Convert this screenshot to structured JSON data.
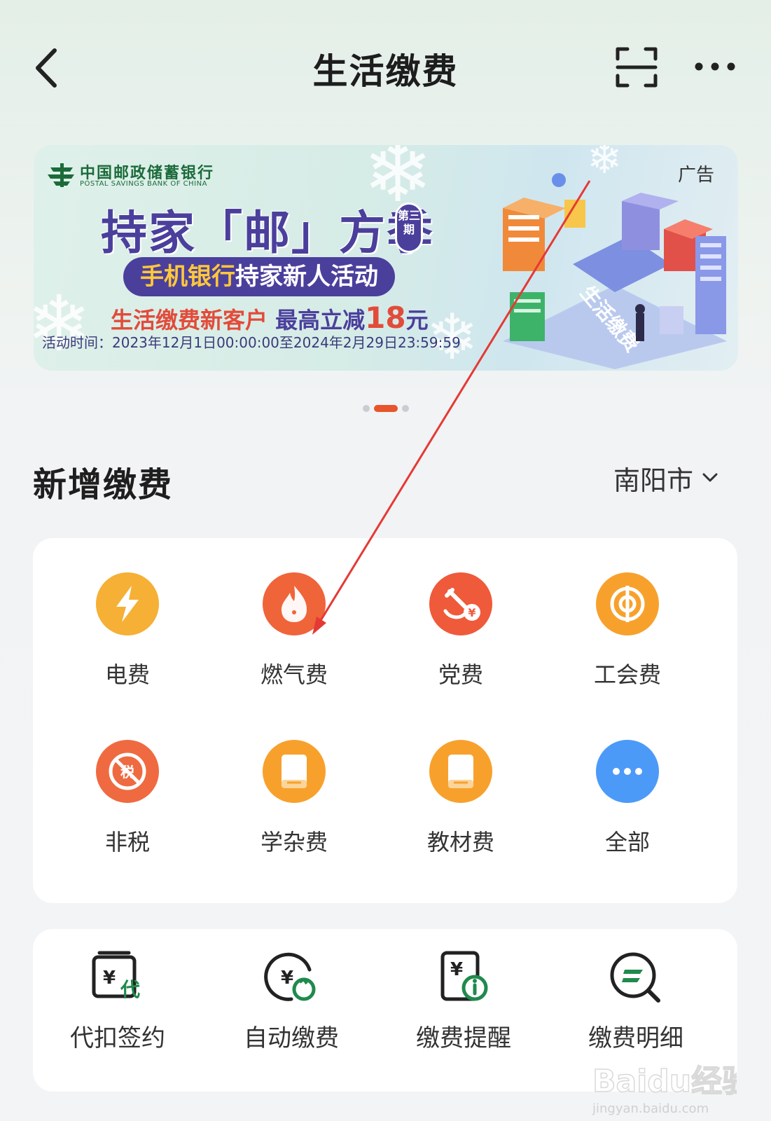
{
  "header": {
    "title": "生活缴费",
    "back_icon": "chevron-left-icon",
    "scan_icon": "scan-icon",
    "more_icon": "more-horizontal-icon"
  },
  "banner": {
    "bank_name": "中国邮政储蓄银行",
    "bank_name_en": "POSTAL SAVINGS BANK OF CHINA",
    "ad_tag": "广告",
    "title": "持家「邮」方季",
    "badge": "第三期",
    "subtitle_highlight": "手机银行",
    "subtitle_rest": "持家新人活动",
    "offer_part1": "生活缴费新客户",
    "offer_part2": "最高立减",
    "offer_amount": "18",
    "offer_unit": "元",
    "time": "活动时间：2023年12月1日00:00:00至2024年2月29日23:59:59",
    "art_street_label": "生活缴费",
    "carousel_total": 3,
    "carousel_active": 2
  },
  "section": {
    "title": "新增缴费",
    "city": "南阳市",
    "city_icon": "chevron-down-icon"
  },
  "payment_types": [
    {
      "label": "电费",
      "icon": "lightning-icon",
      "color": "#f5a623"
    },
    {
      "label": "燃气费",
      "icon": "flame-icon",
      "color": "#f0643a"
    },
    {
      "label": "党费",
      "icon": "party-emblem-icon",
      "color": "#ef5a3a"
    },
    {
      "label": "工会费",
      "icon": "union-emblem-icon",
      "color": "#f7a12c"
    },
    {
      "label": "非税",
      "icon": "tax-icon",
      "color": "#ef6a40"
    },
    {
      "label": "学杂费",
      "icon": "book-icon",
      "color": "#f7a12c"
    },
    {
      "label": "教材费",
      "icon": "textbook-icon",
      "color": "#f7a12c"
    },
    {
      "label": "全部",
      "icon": "more-icon",
      "color": "#3f8ef5"
    }
  ],
  "services": [
    {
      "label": "代扣签约",
      "icon": "proxy-debit-icon"
    },
    {
      "label": "自动缴费",
      "icon": "auto-pay-icon"
    },
    {
      "label": "缴费提醒",
      "icon": "payment-reminder-icon"
    },
    {
      "label": "缴费明细",
      "icon": "payment-detail-icon"
    }
  ],
  "colors": {
    "accent_green": "#1f8a4c",
    "carousel_active": "#e8542b",
    "annotation_arrow": "#e53935"
  },
  "watermark": {
    "brand": "Baidu经验",
    "url": "jingyan.baidu.com"
  }
}
